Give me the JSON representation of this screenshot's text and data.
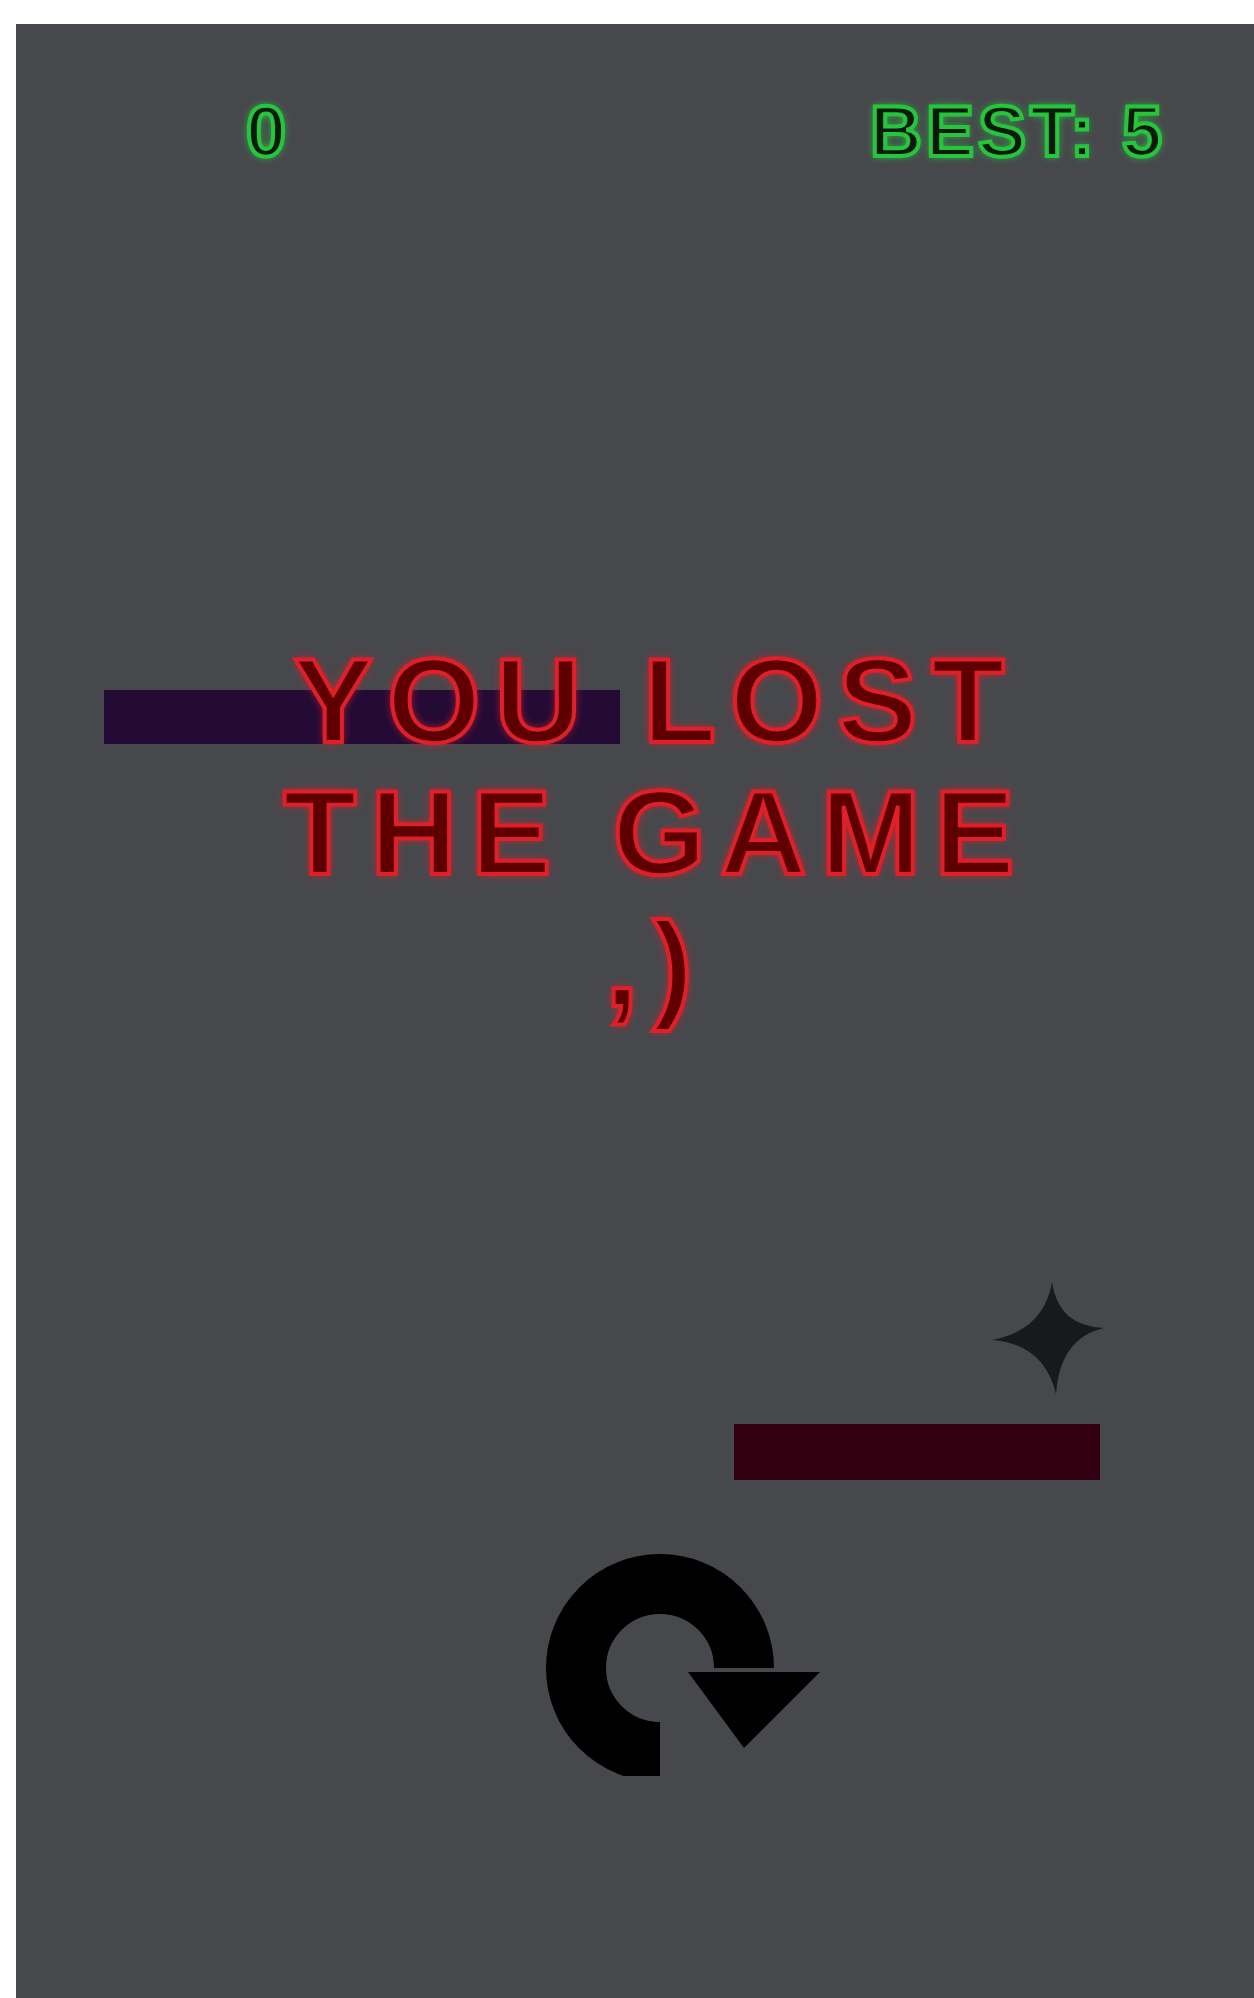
{
  "score": "0",
  "best": "BEST: 5",
  "message_lines": [
    "YOU LOST",
    "THE GAME",
    ",)"
  ],
  "obstacles": [
    {
      "kind": "bar",
      "color": "#230b36"
    },
    {
      "kind": "star",
      "color": "#18191c"
    },
    {
      "kind": "bar",
      "color": "#330012"
    }
  ]
}
